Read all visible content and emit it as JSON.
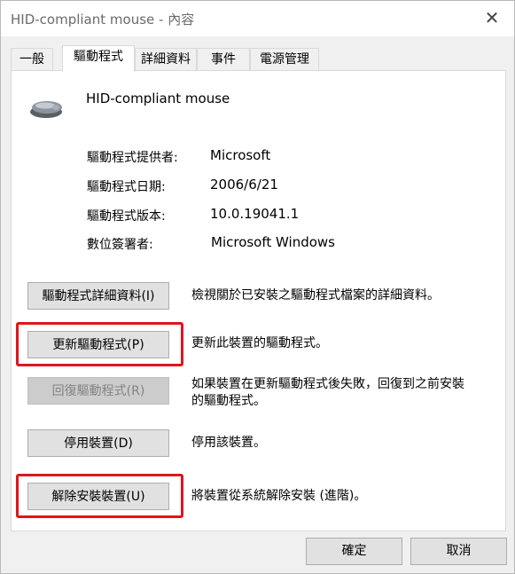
{
  "window": {
    "title": "HID-compliant mouse - 內容",
    "close_glyph": "✕"
  },
  "tabs": [
    {
      "label": "一般",
      "active": false
    },
    {
      "label": "驅動程式",
      "active": true
    },
    {
      "label": "詳細資料",
      "active": false
    },
    {
      "label": "事件",
      "active": false
    },
    {
      "label": "電源管理",
      "active": false
    }
  ],
  "device": {
    "name": "HID-compliant mouse",
    "icon": "mouse-icon"
  },
  "info": [
    {
      "label": "驅動程式提供者:",
      "value": "Microsoft"
    },
    {
      "label": "驅動程式日期:",
      "value": "2006/6/21"
    },
    {
      "label": "驅動程式版本:",
      "value": "10.0.19041.1"
    },
    {
      "label": "數位簽署者:",
      "value": "Microsoft Windows"
    }
  ],
  "actions": [
    {
      "button": "驅動程式詳細資料(I)",
      "description": "檢視關於已安裝之驅動程式檔案的詳細資料。",
      "enabled": true,
      "highlighted": false
    },
    {
      "button": "更新驅動程式(P)",
      "description": "更新此裝置的驅動程式。",
      "enabled": true,
      "highlighted": true
    },
    {
      "button": "回復驅動程式(R)",
      "description": "如果裝置在更新驅動程式後失敗，回復到之前安裝",
      "description2": "的驅動程式。",
      "enabled": false,
      "highlighted": false
    },
    {
      "button": "停用裝置(D)",
      "description": "停用該裝置。",
      "enabled": true,
      "highlighted": false
    },
    {
      "button": "解除安裝裝置(U)",
      "description": "將裝置從系統解除安裝 (進階)。",
      "enabled": true,
      "highlighted": true
    }
  ],
  "footer": {
    "ok_label": "確定",
    "cancel_label": "取消"
  },
  "colors": {
    "highlight": "#e0141e",
    "button_bg": "#e1e1e1",
    "disabled_bg": "#cccccc"
  }
}
